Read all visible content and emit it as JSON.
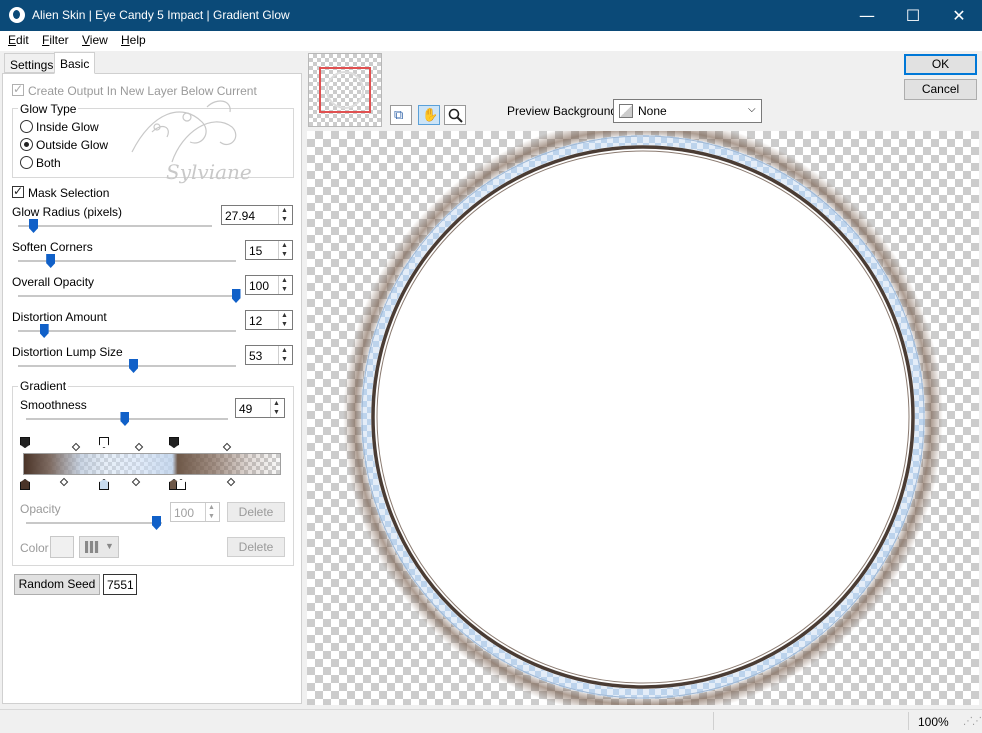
{
  "window": {
    "title": "Alien Skin | Eye Candy 5 Impact | Gradient Glow",
    "minimize_glyph": "—",
    "maximize_glyph": "☐",
    "close_glyph": "✕"
  },
  "menu": [
    {
      "label": "Edit",
      "mnemonic": "E",
      "rest": "dit"
    },
    {
      "label": "Filter",
      "mnemonic": "F",
      "rest": "ilter"
    },
    {
      "label": "View",
      "mnemonic": "V",
      "rest": "iew"
    },
    {
      "label": "Help",
      "mnemonic": "H",
      "rest": "elp"
    }
  ],
  "tabs": {
    "settings": "Settings",
    "basic": "Basic"
  },
  "basic": {
    "create_output_label": "Create Output In New Layer Below Current",
    "create_output_checked": true,
    "glow_type": {
      "title": "Glow Type",
      "options": [
        "Inside Glow",
        "Outside Glow",
        "Both"
      ],
      "selected": "Outside Glow"
    },
    "watermark": "Sylviane",
    "mask_selection_label": "Mask Selection",
    "mask_selection_checked": true,
    "glow_radius": {
      "label": "Glow Radius (pixels)",
      "value": "27.94",
      "fraction": 0.08
    },
    "soften_corners": {
      "label": "Soften Corners",
      "value": "15",
      "fraction": 0.15
    },
    "overall_opacity": {
      "label": "Overall Opacity",
      "value": "100",
      "fraction": 1.0
    },
    "distortion_amount": {
      "label": "Distortion Amount",
      "value": "12",
      "fraction": 0.12
    },
    "distortion_lump_size": {
      "label": "Distortion Lump Size",
      "value": "53",
      "fraction": 0.53
    },
    "gradient": {
      "title": "Gradient",
      "smoothness": {
        "label": "Smoothness",
        "value": "49",
        "fraction": 0.49
      },
      "opacity": {
        "label": "Opacity",
        "value": "100"
      },
      "color_label": "Color",
      "delete_label": "Delete"
    },
    "random_seed": {
      "button_label": "Random Seed",
      "value": "7551"
    }
  },
  "actions": {
    "ok": "OK",
    "cancel": "Cancel"
  },
  "preview_background": {
    "label": "Preview Background:",
    "value": "None"
  },
  "status": {
    "zoom": "100%"
  }
}
